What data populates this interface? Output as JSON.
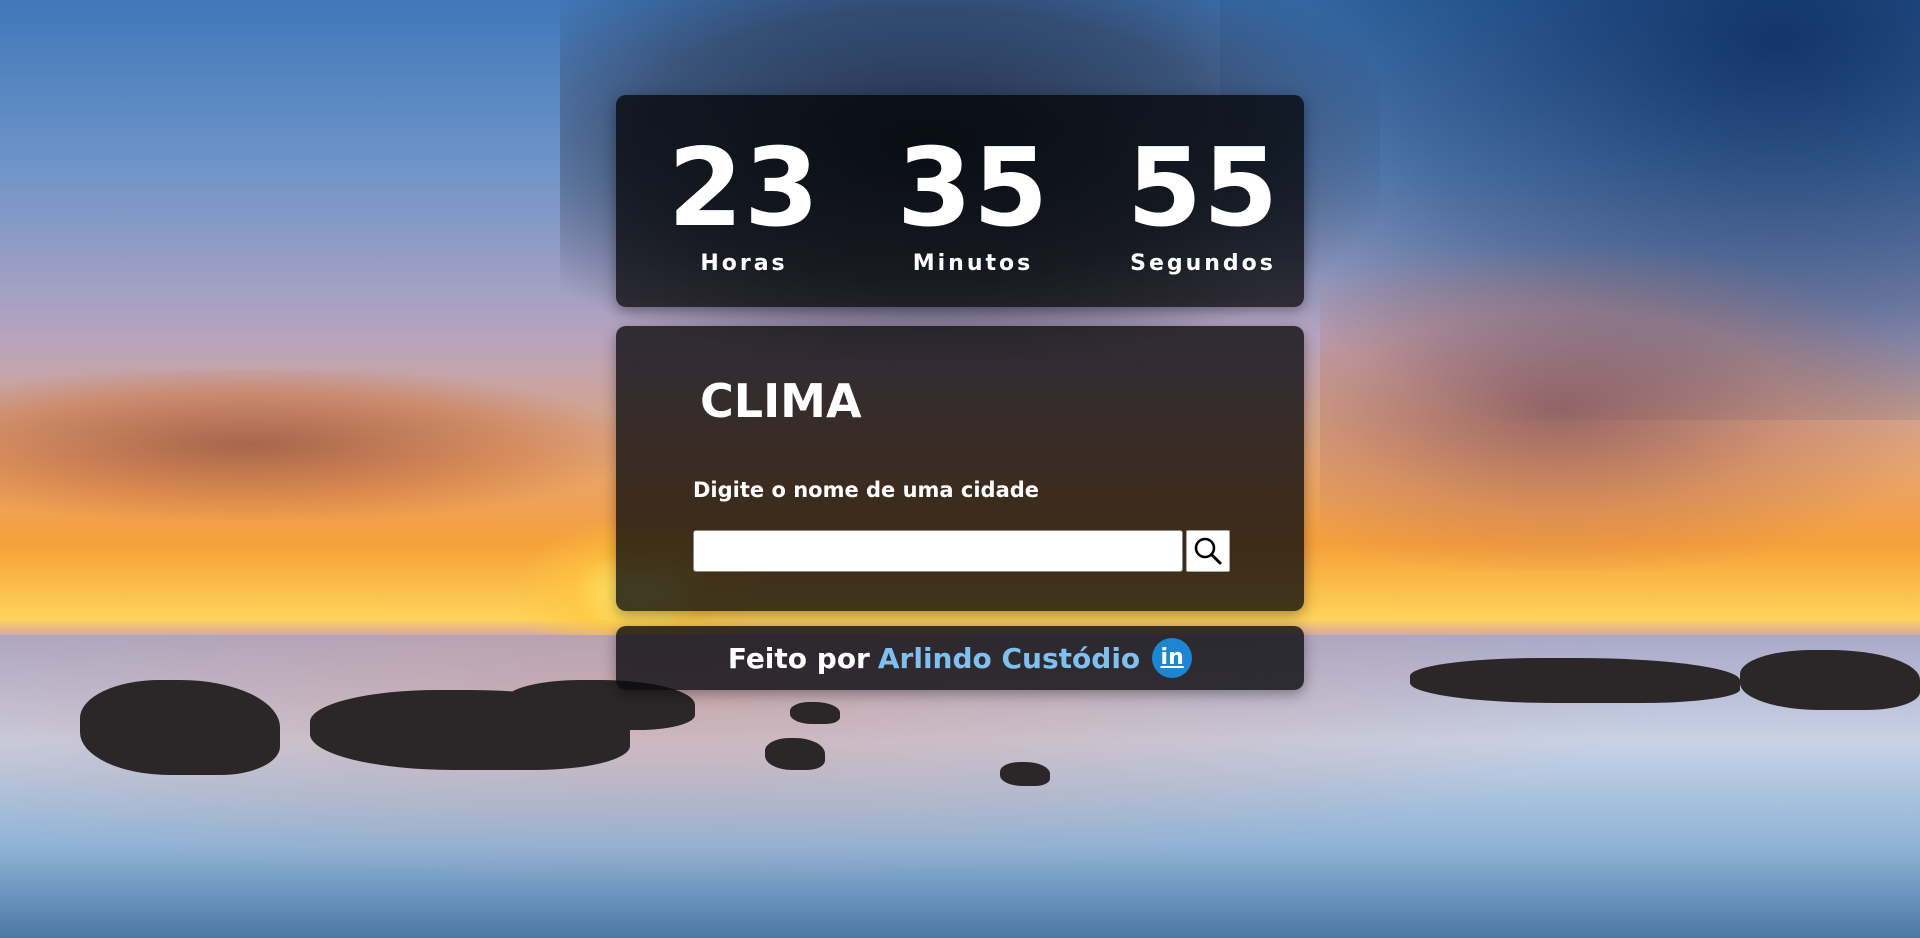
{
  "clock": {
    "hours": "23",
    "hours_label": "Horas",
    "minutes": "35",
    "minutes_label": "Minutos",
    "seconds": "55",
    "seconds_label": "Segundos"
  },
  "weather": {
    "title": "CLIMA",
    "input_label": "Digite o nome de uma cidade",
    "input_value": "",
    "input_placeholder": "",
    "search_icon": "search-icon"
  },
  "footer": {
    "prefix": "Feito por",
    "author": "Arlindo Custódio",
    "social_icon": "linkedin-icon",
    "social_text": "in"
  },
  "colors": {
    "panel_bg": "#000000",
    "author_link": "#7fc0f0",
    "linkedin": "#1d86d2"
  }
}
